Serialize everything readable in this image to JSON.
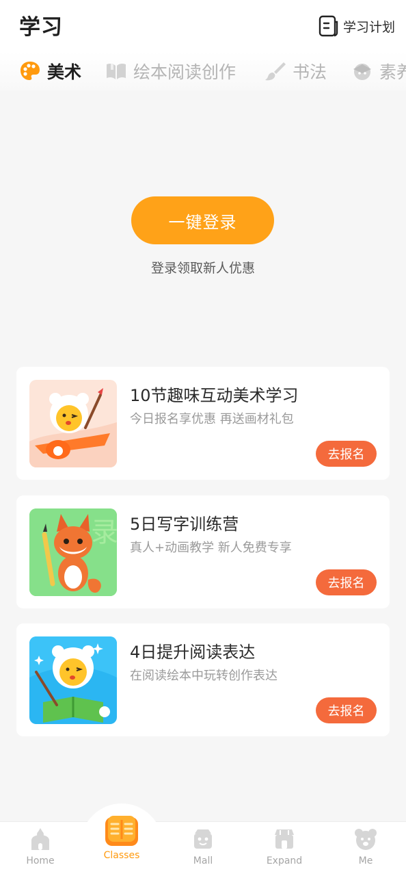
{
  "header": {
    "title": "学习",
    "plan_label": "学习计划"
  },
  "tabs": [
    {
      "label": "美术",
      "icon": "palette-icon",
      "active": true
    },
    {
      "label": "绘本阅读创作",
      "icon": "book-icon",
      "active": false
    },
    {
      "label": "书法",
      "icon": "brush-icon",
      "active": false
    },
    {
      "label": "素养",
      "icon": "cap-icon",
      "active": false
    }
  ],
  "login": {
    "button_label": "一键登录",
    "tip": "登录领取新人优惠"
  },
  "courses": [
    {
      "title": "10节趣味互动美术学习",
      "subtitle": "今日报名享优惠 再送画材礼包",
      "enroll_label": "去报名",
      "thumb": "bear-plane-illustration"
    },
    {
      "title": "5日写字训练营",
      "subtitle": "真人+动画教学 新人免费专享",
      "enroll_label": "去报名",
      "thumb": "fox-pen-illustration"
    },
    {
      "title": "4日提升阅读表达",
      "subtitle": "在阅读绘本中玩转创作表达",
      "enroll_label": "去报名",
      "thumb": "bear-book-illustration"
    }
  ],
  "bottom_nav": [
    {
      "label": "Home",
      "icon": "home-icon",
      "active": false
    },
    {
      "label": "Classes",
      "icon": "classes-book-icon",
      "active": true
    },
    {
      "label": "Mall",
      "icon": "mall-icon",
      "active": false
    },
    {
      "label": "Expand",
      "icon": "expand-icon",
      "active": false
    },
    {
      "label": "Me",
      "icon": "bear-face-icon",
      "active": false
    }
  ],
  "colors": {
    "accent_orange": "#ffa218",
    "enroll_red": "#f46a3c",
    "nav_active": "#ff9a0e",
    "background": "#f6f6f6"
  }
}
